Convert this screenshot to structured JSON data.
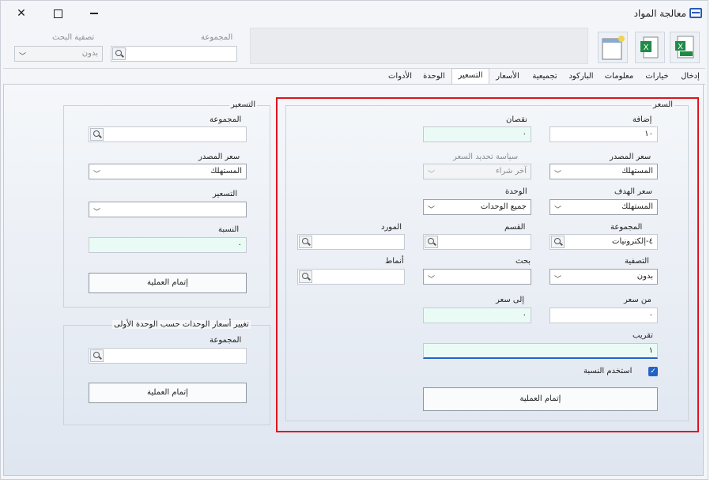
{
  "window": {
    "title": "معالجة المواد"
  },
  "toolbar": {
    "icons": [
      "csv-export-icon",
      "excel-export-icon",
      "new-document-icon"
    ],
    "group_label": "المجموعة",
    "filter_label": "تصفية البحث",
    "filter_value": "بدون"
  },
  "tabs": [
    "إدخال",
    "خيارات",
    "معلومات",
    "الباركود",
    "تجميعية",
    "الأسعار",
    "التسعير",
    "الوحدة",
    "الأدوات"
  ],
  "price": {
    "title": "السعر",
    "add_label": "إضافة",
    "add_value": "١٠",
    "sub_label": "نقصان",
    "sub_value": "٠",
    "source_label": "سعر المصدر",
    "source_value": "المستهلك",
    "policy_label": "سياسة تحديد السعر",
    "policy_value": "آخر شراء",
    "target_label": "سعر الهدف",
    "target_value": "المستهلك",
    "unit_label": "الوحدة",
    "unit_value": "جميع الوحدات",
    "group_label": "المجموعة",
    "group_value": "٤-إلكترونيات",
    "section_label": "القسم",
    "section_value": "",
    "supplier_label": "المورد",
    "supplier_value": "",
    "filter_label": "التصفية",
    "filter_value": "بدون",
    "search_label": "بحث",
    "search_value": "",
    "pattern_label": "أنماط",
    "pattern_value": "",
    "from_label": "من سعر",
    "from_value": "٠",
    "to_label": "إلى سعر",
    "to_value": "٠",
    "round_label": "تقريب",
    "round_value": "١",
    "use_ratio_label": "استخدم النسبة",
    "use_ratio_checked": true,
    "submit_label": "إتمام العملية"
  },
  "pricing": {
    "title": "التسعير",
    "group_label": "المجموعة",
    "group_value": "",
    "source_label": "سعر المصدر",
    "source_value": "المستهلك",
    "pricing_label": "التسعير",
    "pricing_value": "",
    "ratio_label": "النسبة",
    "ratio_value": "٠",
    "submit_label": "إتمام العملية"
  },
  "unit_change": {
    "title": "تغيير أسعار الوحدات حسب الوحدة الأولى",
    "group_label": "المجموعة",
    "group_value": "",
    "submit_label": "إتمام العملية"
  },
  "colors": {
    "accent": "#2463c6",
    "highlight_border": "#e0141e",
    "mint_field": "#eafbf6"
  }
}
